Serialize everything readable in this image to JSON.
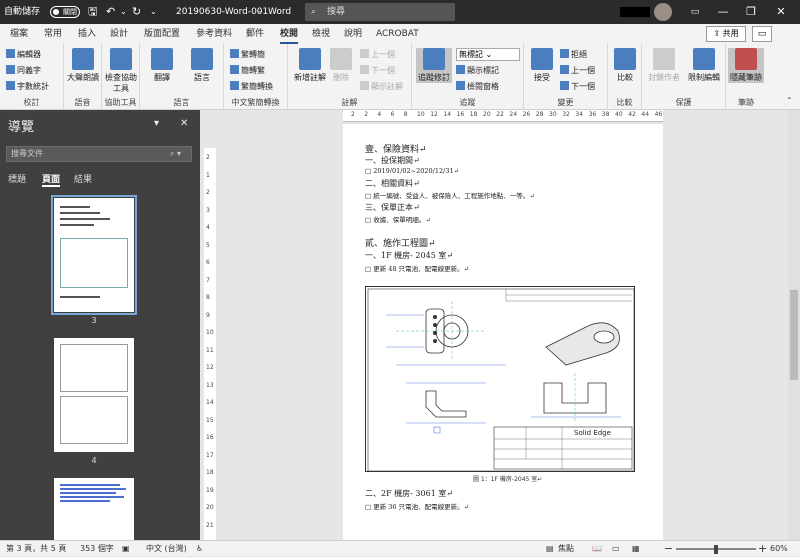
{
  "titlebar": {
    "autosave_label": "自動儲存",
    "autosave_state": "關閉",
    "doc_title": "20190630-Word-001",
    "app_name": "Word",
    "search_placeholder": "搜尋",
    "win_min": "—",
    "win_restore": "❐",
    "win_close": "✕"
  },
  "tabs": [
    "檔案",
    "常用",
    "插入",
    "設計",
    "版面配置",
    "參考資料",
    "郵件",
    "校閱",
    "檢視",
    "說明",
    "ACROBAT"
  ],
  "active_tab": "校閱",
  "share_label": "共用",
  "ribbon": {
    "proofing": {
      "label": "校訂",
      "items": [
        "編輯器",
        "同義字",
        "字數統計"
      ]
    },
    "speech": {
      "label": "語音",
      "read_aloud": "大聲朗讀"
    },
    "accessibility": {
      "label": "協助工具",
      "check": "檢查協助工具"
    },
    "language": {
      "label": "語言",
      "translate": "翻譯",
      "language": "語言"
    },
    "chinese_conversion": {
      "label": "中文繁簡轉換",
      "items": [
        "繁轉簡",
        "簡轉繁",
        "繁簡轉換"
      ]
    },
    "comments": {
      "label": "註解",
      "new_comment": "新增註解",
      "delete": "刪除",
      "previous": "上一個",
      "next": "下一個",
      "show_comments": "顯示註解"
    },
    "tracking": {
      "label": "追蹤",
      "track_changes": "追蹤修訂",
      "markup_select": "無標記",
      "show_markup": "顯示標記",
      "reviewing_pane": "檢閱窗格"
    },
    "changes": {
      "label": "變更",
      "accept": "接受",
      "reject": "拒絕",
      "previous": "上一個",
      "next": "下一個"
    },
    "compare": {
      "label": "比較",
      "compare": "比較"
    },
    "protect": {
      "label": "保護",
      "block_authors": "封鎖作者",
      "restrict_editing": "限制編輯"
    },
    "ink": {
      "label": "筆跡",
      "hide_ink": "隱藏筆跡"
    }
  },
  "nav": {
    "title": "導覽",
    "search_placeholder": "搜尋文件",
    "tabs": [
      "標題",
      "頁面",
      "結果"
    ],
    "active_tab": "頁面",
    "pages": [
      {
        "label": "3"
      },
      {
        "label": "4"
      }
    ]
  },
  "ruler": {
    "top": [
      "2",
      "2",
      "4",
      "6",
      "8",
      "10",
      "12",
      "14",
      "16",
      "18",
      "20",
      "22",
      "24",
      "26",
      "28",
      "30",
      "32",
      "34",
      "36",
      "38",
      "40",
      "42",
      "44",
      "46"
    ],
    "left": [
      "2",
      "1",
      "2",
      "3",
      "4",
      "5",
      "6",
      "7",
      "8",
      "9",
      "10",
      "11",
      "12",
      "13",
      "14",
      "15",
      "16",
      "17",
      "18",
      "19",
      "20",
      "21"
    ]
  },
  "document": {
    "sec1": "壹、保險資料↵",
    "sec1_item1": "一、投保期間↵",
    "sec1_item1_val": "□ 2019/01/02~2020/12/31↵",
    "sec1_item2": "二、相關資料↵",
    "sec1_item2_val": "□ 統一編號、受益人、被保險人、工程施作地點、一等。↵",
    "sec1_item3": "三、保單正本↵",
    "sec1_item3_val": "□ 收據、保單明細。↵",
    "sec2": "貳、施作工程圖↵",
    "sec2_item1": "一、1F 機房- 2045 室↵",
    "sec2_item1_val": "□ 更新 48 只電池、配電線更新。↵",
    "drawing_brand": "Solid Edge",
    "caption": "圖 1：1F 機房-2045 室↵",
    "sec2_item2": "二、2F 機房- 3061 室↵",
    "sec2_item2_val": "□ 更新 36 只電池、配電線更新。↵"
  },
  "status": {
    "page": "第 3 頁，共 5 頁",
    "words": "353 個字",
    "language": "中文 (台灣)",
    "focus": "焦點",
    "zoom": "60%",
    "minus": "−",
    "plus": "+"
  },
  "colors": {
    "titlebar": "#2b2b2b",
    "nav": "#404040",
    "accent": "#2b579a"
  }
}
